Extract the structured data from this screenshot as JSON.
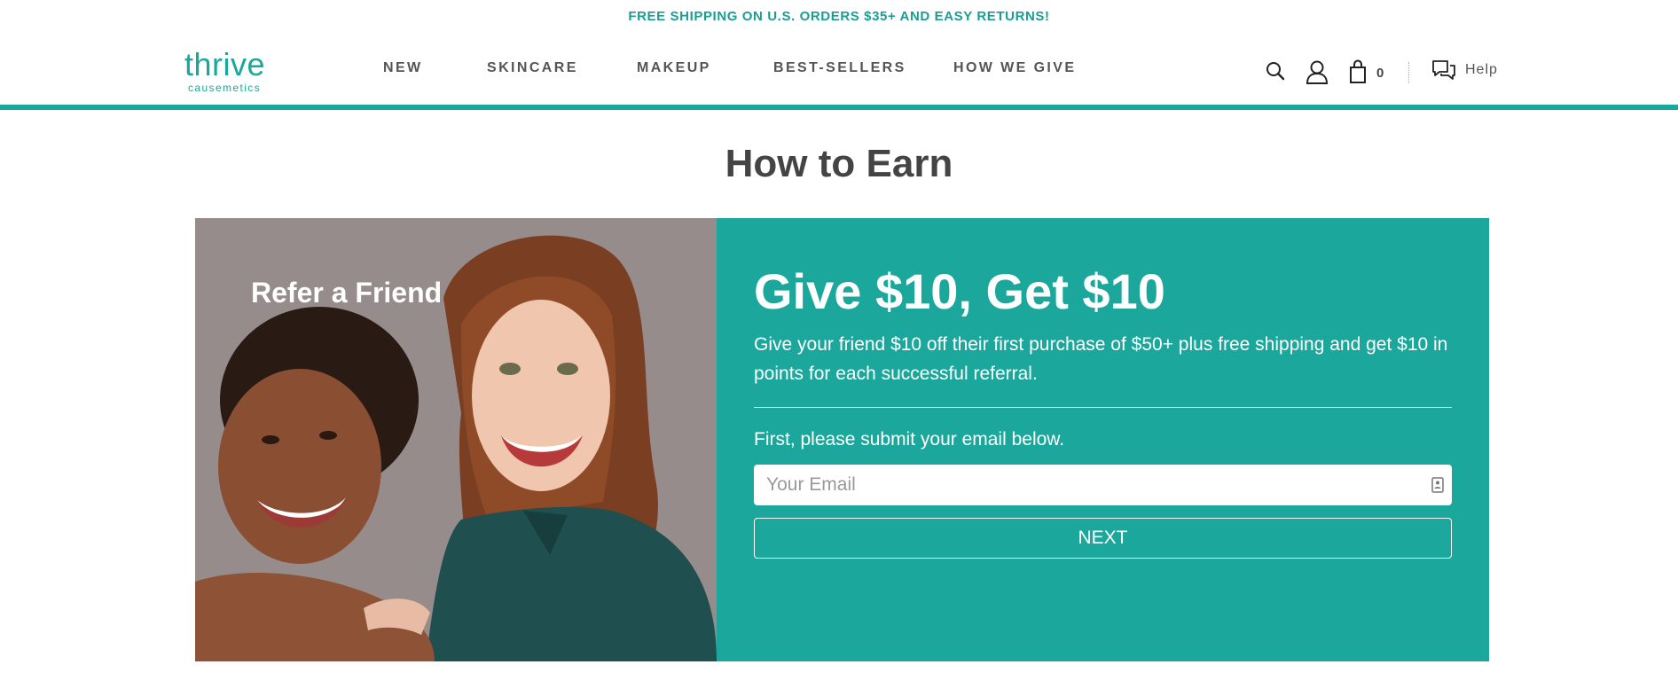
{
  "promo_banner": "FREE SHIPPING ON U.S. ORDERS $35+ AND EASY RETURNS!",
  "brand": {
    "name": "thrive",
    "tagline": "causemetics",
    "accent_color": "#1ba79c"
  },
  "nav": {
    "items": [
      {
        "label": "NEW"
      },
      {
        "label": "SKINCARE"
      },
      {
        "label": "MAKEUP"
      },
      {
        "label": "BEST-SELLERS"
      },
      {
        "label": "HOW WE GIVE"
      }
    ]
  },
  "utility": {
    "search_icon": "search-icon",
    "account_icon": "user-icon",
    "cart_icon": "shopping-bag-icon",
    "cart_count": "0",
    "help_icon": "chat-bubbles-icon",
    "help_label": "Help"
  },
  "page_title": "How to Earn",
  "referral": {
    "image_label": "Refer a Friend",
    "heading": "Give $10, Get $10",
    "description": "Give your friend $10 off their first purchase of $50+ plus free shipping and get $10 in points for each successful referral.",
    "email_prompt": "First, please submit your email below.",
    "email_placeholder": "Your Email",
    "email_value": "",
    "next_label": "NEXT"
  }
}
